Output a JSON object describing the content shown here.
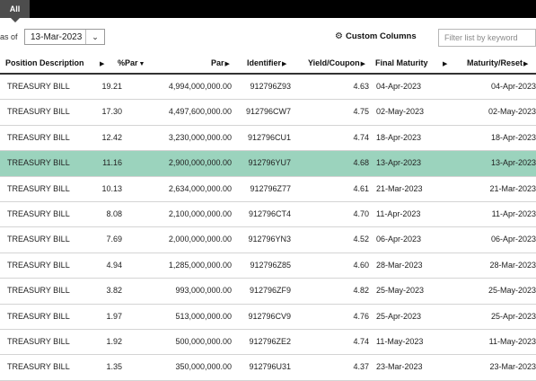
{
  "tabs": {
    "active": "All"
  },
  "toolbar": {
    "as_of_label": "as of",
    "date_value": "13-Mar-2023",
    "date_dropdown_icon": "chevron-down-icon",
    "custom_columns_label": "Custom Columns",
    "custom_columns_icon": "gear-icon",
    "filter_placeholder": "Filter list by keyword"
  },
  "table": {
    "columns": [
      "Position Description",
      "%Par",
      "Par",
      "Identifier",
      "Yield/Coupon",
      "Final Maturity",
      "Maturity/Reset"
    ],
    "sort_column": "%Par",
    "rows": [
      {
        "desc": "TREASURY BILL",
        "pct": "19.21",
        "par": "4,994,000,000.00",
        "id": "912796Z93",
        "yield": "4.63",
        "final": "04-Apr-2023",
        "reset": "04-Apr-2023"
      },
      {
        "desc": "TREASURY BILL",
        "pct": "17.30",
        "par": "4,497,600,000.00",
        "id": "912796CW7",
        "yield": "4.75",
        "final": "02-May-2023",
        "reset": "02-May-2023"
      },
      {
        "desc": "TREASURY BILL",
        "pct": "12.42",
        "par": "3,230,000,000.00",
        "id": "912796CU1",
        "yield": "4.74",
        "final": "18-Apr-2023",
        "reset": "18-Apr-2023"
      },
      {
        "desc": "TREASURY BILL",
        "pct": "11.16",
        "par": "2,900,000,000.00",
        "id": "912796YU7",
        "yield": "4.68",
        "final": "13-Apr-2023",
        "reset": "13-Apr-2023"
      },
      {
        "desc": "TREASURY BILL",
        "pct": "10.13",
        "par": "2,634,000,000.00",
        "id": "912796Z77",
        "yield": "4.61",
        "final": "21-Mar-2023",
        "reset": "21-Mar-2023"
      },
      {
        "desc": "TREASURY BILL",
        "pct": "8.08",
        "par": "2,100,000,000.00",
        "id": "912796CT4",
        "yield": "4.70",
        "final": "11-Apr-2023",
        "reset": "11-Apr-2023"
      },
      {
        "desc": "TREASURY BILL",
        "pct": "7.69",
        "par": "2,000,000,000.00",
        "id": "912796YN3",
        "yield": "4.52",
        "final": "06-Apr-2023",
        "reset": "06-Apr-2023"
      },
      {
        "desc": "TREASURY BILL",
        "pct": "4.94",
        "par": "1,285,000,000.00",
        "id": "912796Z85",
        "yield": "4.60",
        "final": "28-Mar-2023",
        "reset": "28-Mar-2023"
      },
      {
        "desc": "TREASURY BILL",
        "pct": "3.82",
        "par": "993,000,000.00",
        "id": "912796ZF9",
        "yield": "4.82",
        "final": "25-May-2023",
        "reset": "25-May-2023"
      },
      {
        "desc": "TREASURY BILL",
        "pct": "1.97",
        "par": "513,000,000.00",
        "id": "912796CV9",
        "yield": "4.76",
        "final": "25-Apr-2023",
        "reset": "25-Apr-2023"
      },
      {
        "desc": "TREASURY BILL",
        "pct": "1.92",
        "par": "500,000,000.00",
        "id": "912796ZE2",
        "yield": "4.74",
        "final": "11-May-2023",
        "reset": "11-May-2023"
      },
      {
        "desc": "TREASURY BILL",
        "pct": "1.35",
        "par": "350,000,000.00",
        "id": "912796U31",
        "yield": "4.37",
        "final": "23-Mar-2023",
        "reset": "23-Mar-2023"
      }
    ],
    "selected_row": 3
  },
  "colors": {
    "topbar": "#000000",
    "tab_active": "#4d4d4d",
    "selected_row": "#9bd3bd",
    "row_divider": "#d4d4d4"
  }
}
